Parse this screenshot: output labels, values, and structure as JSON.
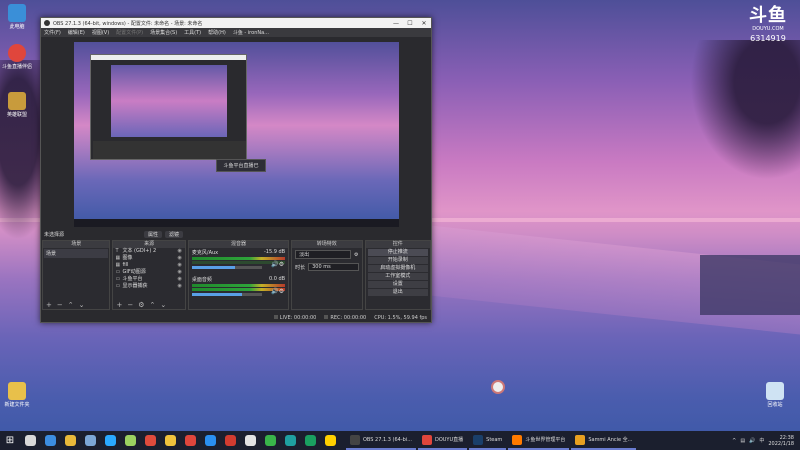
{
  "desktop": {
    "icons_left": [
      {
        "label": "此电脑",
        "color": "#3a8fd8"
      },
      {
        "label": "斗鱼直播伴侣",
        "color": "#e0463c"
      },
      {
        "label": "英雄联盟",
        "color": "#c89b3c"
      }
    ],
    "icons_bottom_left": {
      "label": "新建文件夹",
      "color": "#e8c04a"
    },
    "icons_bottom_right": {
      "label": "回收站",
      "color": "#cfe3f3"
    },
    "watermark": {
      "logo": "斗鱼",
      "site": "DOUYU.COM",
      "room": "6314919"
    }
  },
  "obs": {
    "title": "OBS 27.1.3 (64-bit, windows) - 配置文件: 未命名 - 场景: 未命名",
    "window_controls": [
      "—",
      "☐",
      "✕"
    ],
    "menu": [
      "文件(F)",
      "编辑(E)",
      "视图(V)",
      "配置文件(P)",
      "场景集合(S)",
      "工具(T)",
      "帮助(H)",
      "斗鱼 - ironNa..."
    ],
    "toast": "斗鱼平台直播已",
    "mode_label": "未选择源",
    "mode_tabs": [
      "属性",
      "滤镜"
    ],
    "docks": {
      "scenes": {
        "header": "场景",
        "items": [
          "场景"
        ]
      },
      "sources": {
        "header": "来源",
        "items": [
          {
            "icon": "T",
            "label": "文本 (GDI+) 2"
          },
          {
            "icon": "▦",
            "label": "图像"
          },
          {
            "icon": "▦",
            "label": "fill"
          },
          {
            "icon": "▭",
            "label": "GIF动图源"
          },
          {
            "icon": "▭",
            "label": "斗鱼平台"
          },
          {
            "icon": "▭",
            "label": "显示器捕获"
          }
        ]
      },
      "mixer": {
        "header": "混音器",
        "channels": [
          {
            "name": "麦克风/Aux",
            "db": "-15.9 dB",
            "level": 0.62
          },
          {
            "name": "桌面音频",
            "db": "0.0 dB",
            "level": 0.72
          }
        ]
      },
      "transitions": {
        "header": "转场特效",
        "type": "淡出",
        "duration_label": "时长",
        "duration": "300 ms"
      },
      "controls": {
        "header": "控件",
        "buttons": [
          "停止推流",
          "开始录制",
          "启动虚拟摄像机",
          "工作室模式",
          "设置",
          "退出"
        ]
      }
    },
    "statusbar": {
      "live_label": "LIVE:",
      "live": "00:00:00",
      "rec_label": "REC:",
      "rec": "00:00:00",
      "cpu": "CPU: 1.5%, 59.94 fps"
    }
  },
  "taskbar": {
    "pinned_colors": [
      "#d8d8d8",
      "#3c8de0",
      "#e8b93a",
      "#7ca7d6",
      "#2aa9ff",
      "#9bd160",
      "#e04b3c",
      "#f0c23c",
      "#e0463c",
      "#2a8ff0",
      "#d23c30",
      "#e2e2e2",
      "#39b54a",
      "#1fa0a0",
      "#1aa060",
      "#ffd000"
    ],
    "apps": [
      {
        "label": "OBS 27.1.3 (64-bi...",
        "color": "#444"
      },
      {
        "label": "DOUYU直播",
        "color": "#e0463c"
      },
      {
        "label": "Steam",
        "color": "#1a3f6a"
      },
      {
        "label": "斗鱼世界管理平台",
        "color": "#ff7a00"
      },
      {
        "label": "Sammi Ancie 全...",
        "color": "#e8a020"
      }
    ],
    "clock_time": "22:38",
    "clock_date": "2022/1/18"
  }
}
